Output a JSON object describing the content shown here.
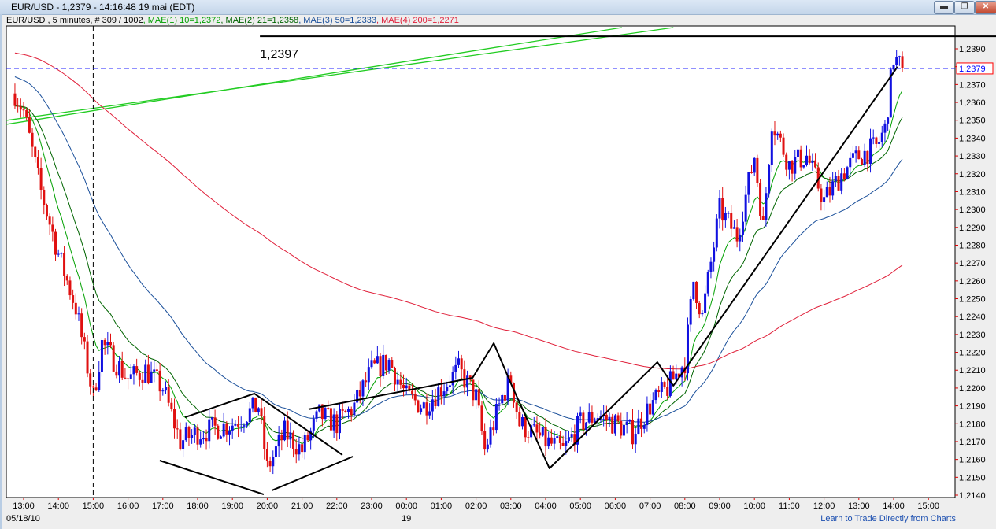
{
  "window": {
    "title": "EUR/USD - 1,2379 - 14:16:48  19 mai (EDT)",
    "minimize": "minimize",
    "restore": "restore",
    "close": "close"
  },
  "info": {
    "symbol": "EUR/USD , 5 minutes, # 309 / 1002",
    "ma1": ", MAE(1) 10=1,2372",
    "ma2": ", MAE(2) 21=1,2358",
    "ma3": ", MAE(3) 50=1,2333",
    "ma4": ", MAE(4) 200=1,2271"
  },
  "footer": {
    "link": "Learn to Trade Directly from Charts"
  },
  "colors": {
    "up": "#1010e0",
    "down": "#e01010",
    "ma1": "#00a000",
    "ma2": "#006400",
    "ma3": "#1a4f9a",
    "ma4": "#e0203a",
    "current_line": "#2020ff",
    "channel": "#22cc22"
  },
  "chart_data": {
    "type": "candlestick",
    "symbol": "EUR/USD",
    "timeframe": "5 minutes",
    "current_price": "1,2379",
    "current_value": 1.2379,
    "ylim": [
      1.2135,
      1.2405
    ],
    "yticks": [
      "1,2140",
      "1,2150",
      "1,2160",
      "1,2170",
      "1,2180",
      "1,2190",
      "1,2200",
      "1,2210",
      "1,2220",
      "1,2230",
      "1,2240",
      "1,2250",
      "1,2260",
      "1,2270",
      "1,2280",
      "1,2290",
      "1,2300",
      "1,2310",
      "1,2320",
      "1,2330",
      "1,2340",
      "1,2350",
      "1,2360",
      "1,2370",
      "1,2380",
      "1,2390"
    ],
    "xticks": [
      "13:00",
      "14:00",
      "15:00",
      "16:00",
      "17:00",
      "18:00",
      "19:00",
      "20:00",
      "21:00",
      "22:00",
      "23:00",
      "00:00",
      "01:00",
      "02:00",
      "03:00",
      "04:00",
      "05:00",
      "06:00",
      "07:00",
      "08:00",
      "09:00",
      "10:00",
      "11:00",
      "12:00",
      "13:00",
      "14:00",
      "15:00"
    ],
    "date_labels": [
      {
        "t": 0,
        "text": "05/18/10"
      },
      {
        "t": 11,
        "text": "19"
      }
    ],
    "note": "t = hours since 13:00 on 05/18/10",
    "path": [
      [
        -0.25,
        1.2365
      ],
      [
        0,
        1.2355
      ],
      [
        0.5,
        1.231
      ],
      [
        1,
        1.2275
      ],
      [
        1.5,
        1.2245
      ],
      [
        2,
        1.2195
      ],
      [
        2.25,
        1.2225
      ],
      [
        3,
        1.2205
      ],
      [
        3.5,
        1.221
      ],
      [
        4,
        1.22
      ],
      [
        4.5,
        1.217
      ],
      [
        5,
        1.2175
      ],
      [
        6,
        1.218
      ],
      [
        6.75,
        1.219
      ],
      [
        7,
        1.2155
      ],
      [
        7.5,
        1.2175
      ],
      [
        8,
        1.2165
      ],
      [
        8.5,
        1.2185
      ],
      [
        9,
        1.218
      ],
      [
        9.5,
        1.219
      ],
      [
        10,
        1.221
      ],
      [
        10.5,
        1.2215
      ],
      [
        11,
        1.2195
      ],
      [
        11.5,
        1.219
      ],
      [
        12,
        1.22
      ],
      [
        12.5,
        1.221
      ],
      [
        13,
        1.2195
      ],
      [
        13.25,
        1.2165
      ],
      [
        13.75,
        1.2195
      ],
      [
        14,
        1.2205
      ],
      [
        14.25,
        1.218
      ],
      [
        15,
        1.217
      ],
      [
        15.5,
        1.2165
      ],
      [
        16,
        1.218
      ],
      [
        16.5,
        1.2185
      ],
      [
        17,
        1.218
      ],
      [
        17.5,
        1.2175
      ],
      [
        18,
        1.219
      ],
      [
        18.5,
        1.22
      ],
      [
        19,
        1.2215
      ],
      [
        19.25,
        1.226
      ],
      [
        19.5,
        1.224
      ],
      [
        20,
        1.23
      ],
      [
        20.5,
        1.2285
      ],
      [
        21,
        1.233
      ],
      [
        21.25,
        1.229
      ],
      [
        21.5,
        1.235
      ],
      [
        22,
        1.2325
      ],
      [
        22.5,
        1.233
      ],
      [
        23,
        1.2305
      ],
      [
        23.5,
        1.232
      ],
      [
        24,
        1.233
      ],
      [
        24.5,
        1.2335
      ],
      [
        24.75,
        1.2345
      ],
      [
        25,
        1.2385
      ],
      [
        25.25,
        1.2379
      ]
    ],
    "ma_periods": [
      10,
      21,
      50,
      200
    ],
    "hline": {
      "price": 1.2397,
      "label": "1,2397",
      "t0": 6.79
    },
    "vline_t": 2,
    "drawings_black": [
      [
        [
          4.64,
          1.21836
        ],
        [
          6.63,
          1.21969
        ],
        [
          9.16,
          1.21625
        ]
      ],
      [
        [
          3.91,
          1.21594
        ],
        [
          6.9,
          1.21404
        ]
      ],
      [
        [
          7.13,
          1.21426
        ],
        [
          9.46,
          1.21616
        ]
      ],
      [
        [
          8.19,
          1.21881
        ],
        [
          12.9,
          1.22057
        ],
        [
          13.51,
          1.22251
        ],
        [
          14.03,
          1.22013
        ],
        [
          15.11,
          1.2155
        ],
        [
          18.21,
          1.22145
        ],
        [
          18.67,
          1.22013
        ],
        [
          25.11,
          1.23799
        ]
      ]
    ],
    "drawings_green": [
      [
        [
          -0.5,
          1.23477
        ],
        [
          17.19,
          1.24019
        ]
      ],
      [
        [
          -0.5,
          1.23499
        ],
        [
          18.67,
          1.24019
        ]
      ]
    ]
  }
}
